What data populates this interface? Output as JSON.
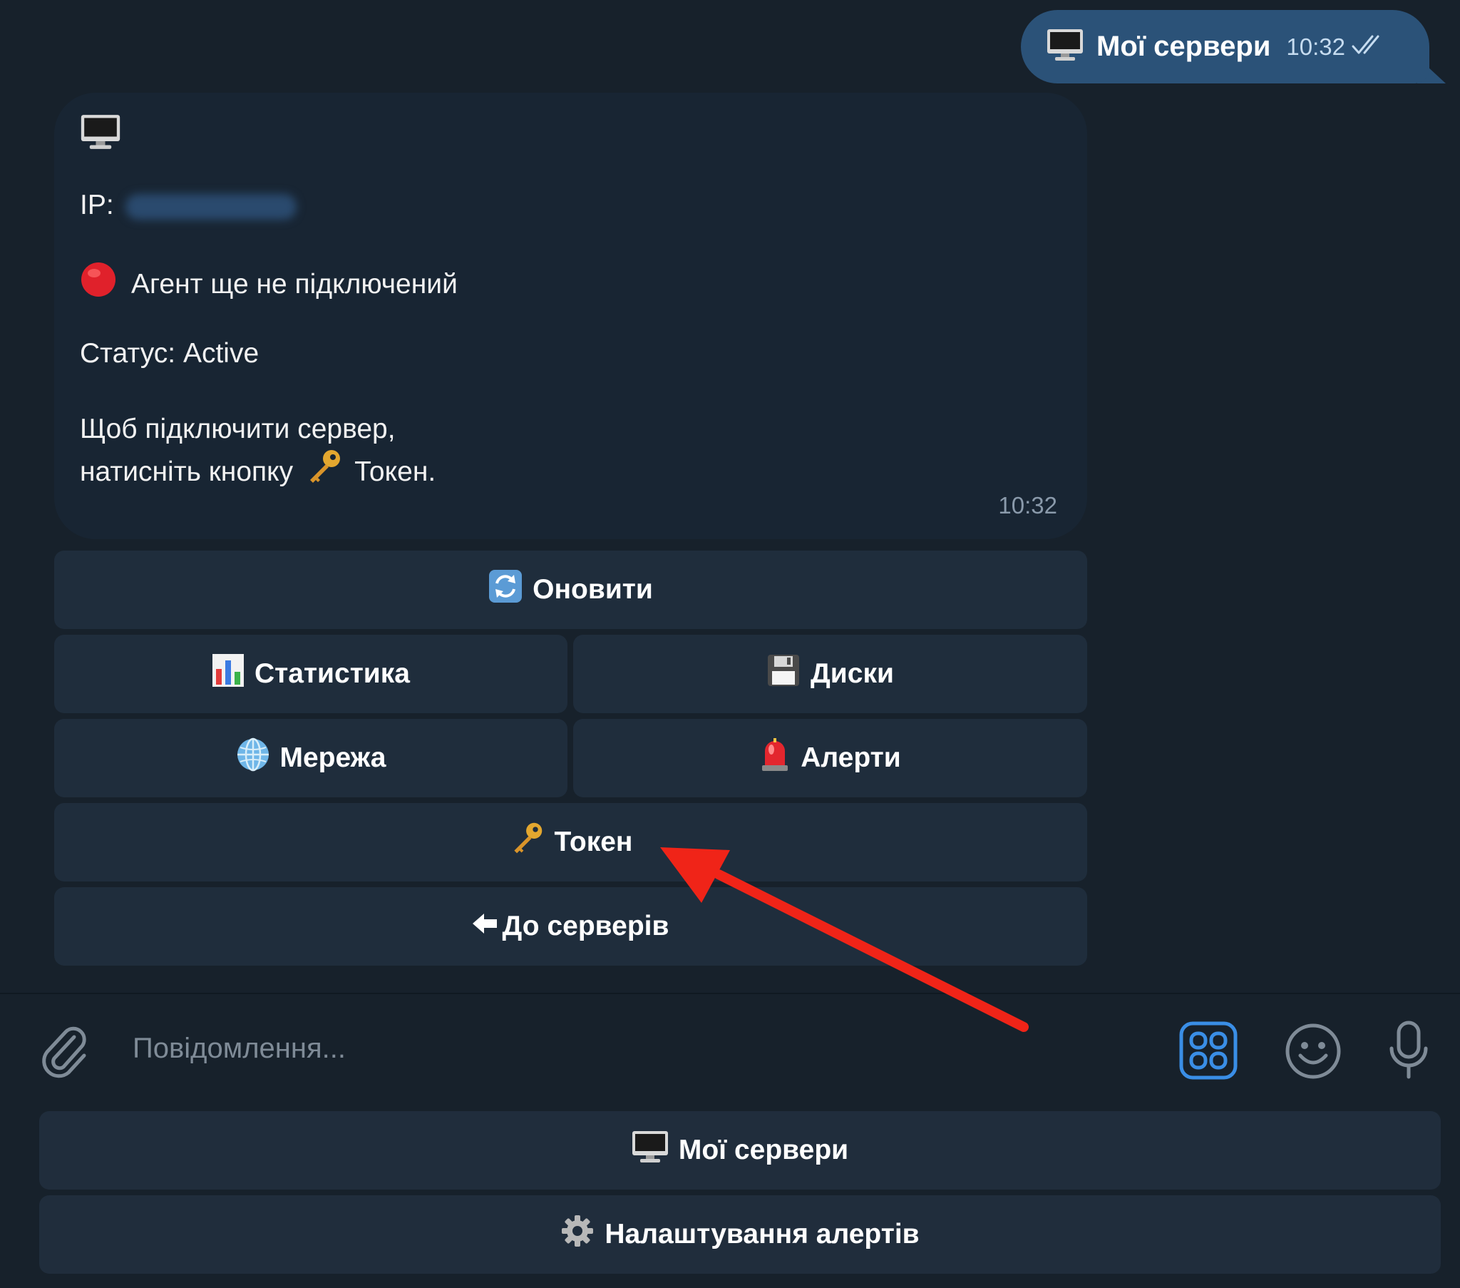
{
  "outgoing_message": {
    "icon": "desktop-computer-icon",
    "text": "Мої сервери",
    "time": "10:32"
  },
  "incoming_message": {
    "header_icon": "desktop-computer-icon",
    "ip_label": "IP:",
    "agent_status_icon": "red-circle-icon",
    "agent_status_text": "Агент ще не підключений",
    "status_line": "Статус: Active",
    "hint_line1": "Щоб підключити сервер,",
    "hint_line2_prefix": "натисніть кнопку",
    "hint_line2_key_icon": "key-icon",
    "hint_line2_suffix": "Токен.",
    "time": "10:32"
  },
  "inline_keyboard": {
    "refresh": {
      "label": "Оновити",
      "icon": "refresh-icon"
    },
    "stats": {
      "label": "Статистика",
      "icon": "bar-chart-icon"
    },
    "disks": {
      "label": "Диски",
      "icon": "floppy-disk-icon"
    },
    "network": {
      "label": "Мережа",
      "icon": "globe-icon"
    },
    "alerts": {
      "label": "Алерти",
      "icon": "siren-icon"
    },
    "token": {
      "label": "Токен",
      "icon": "key-icon"
    },
    "back": {
      "label": "До серверів",
      "icon": "left-arrow-icon"
    }
  },
  "input_bar": {
    "placeholder": "Повідомлення...",
    "attach_icon": "paperclip-icon",
    "bot_commands_icon": "bot-keyboard-icon",
    "emoji_icon": "smiley-icon",
    "mic_icon": "microphone-icon"
  },
  "reply_keyboard": {
    "my_servers": {
      "label": "Мої сервери",
      "icon": "desktop-computer-icon"
    },
    "alert_settings": {
      "label": "Налаштування алертів",
      "icon": "gear-icon"
    }
  },
  "annotation": {
    "arrow_color": "#f02418"
  },
  "colors": {
    "background": "#17212b",
    "outgoing_bubble": "#2b5278",
    "incoming_bubble": "#182533",
    "button": "#1f2d3c",
    "accent": "#3a8ee6"
  }
}
